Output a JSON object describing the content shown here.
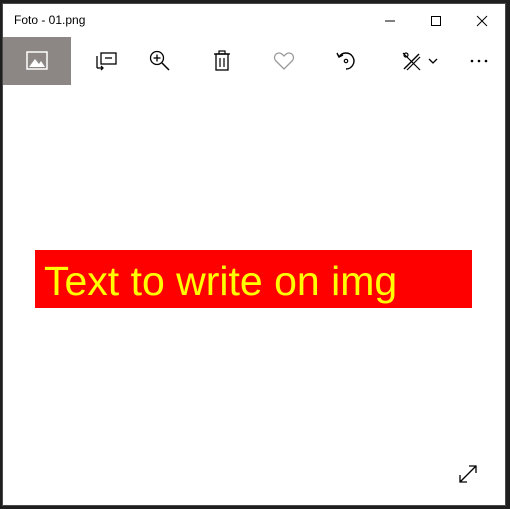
{
  "window": {
    "title": "Foto - 01.png"
  },
  "toolbar": {
    "items": [
      {
        "name": "view-image",
        "active": true
      },
      {
        "name": "slideshow"
      },
      {
        "name": "zoom"
      },
      {
        "name": "delete"
      },
      {
        "name": "favorite"
      },
      {
        "name": "rotate"
      },
      {
        "name": "edit"
      },
      {
        "name": "more"
      }
    ]
  },
  "photo": {
    "text": "Text to write on img",
    "background": "#ff0000",
    "text_color": "#ffff00"
  },
  "colors": {
    "active_tool_bg": "#8c8784",
    "icon": "#000000",
    "disabled_icon": "#9a9a9a"
  }
}
